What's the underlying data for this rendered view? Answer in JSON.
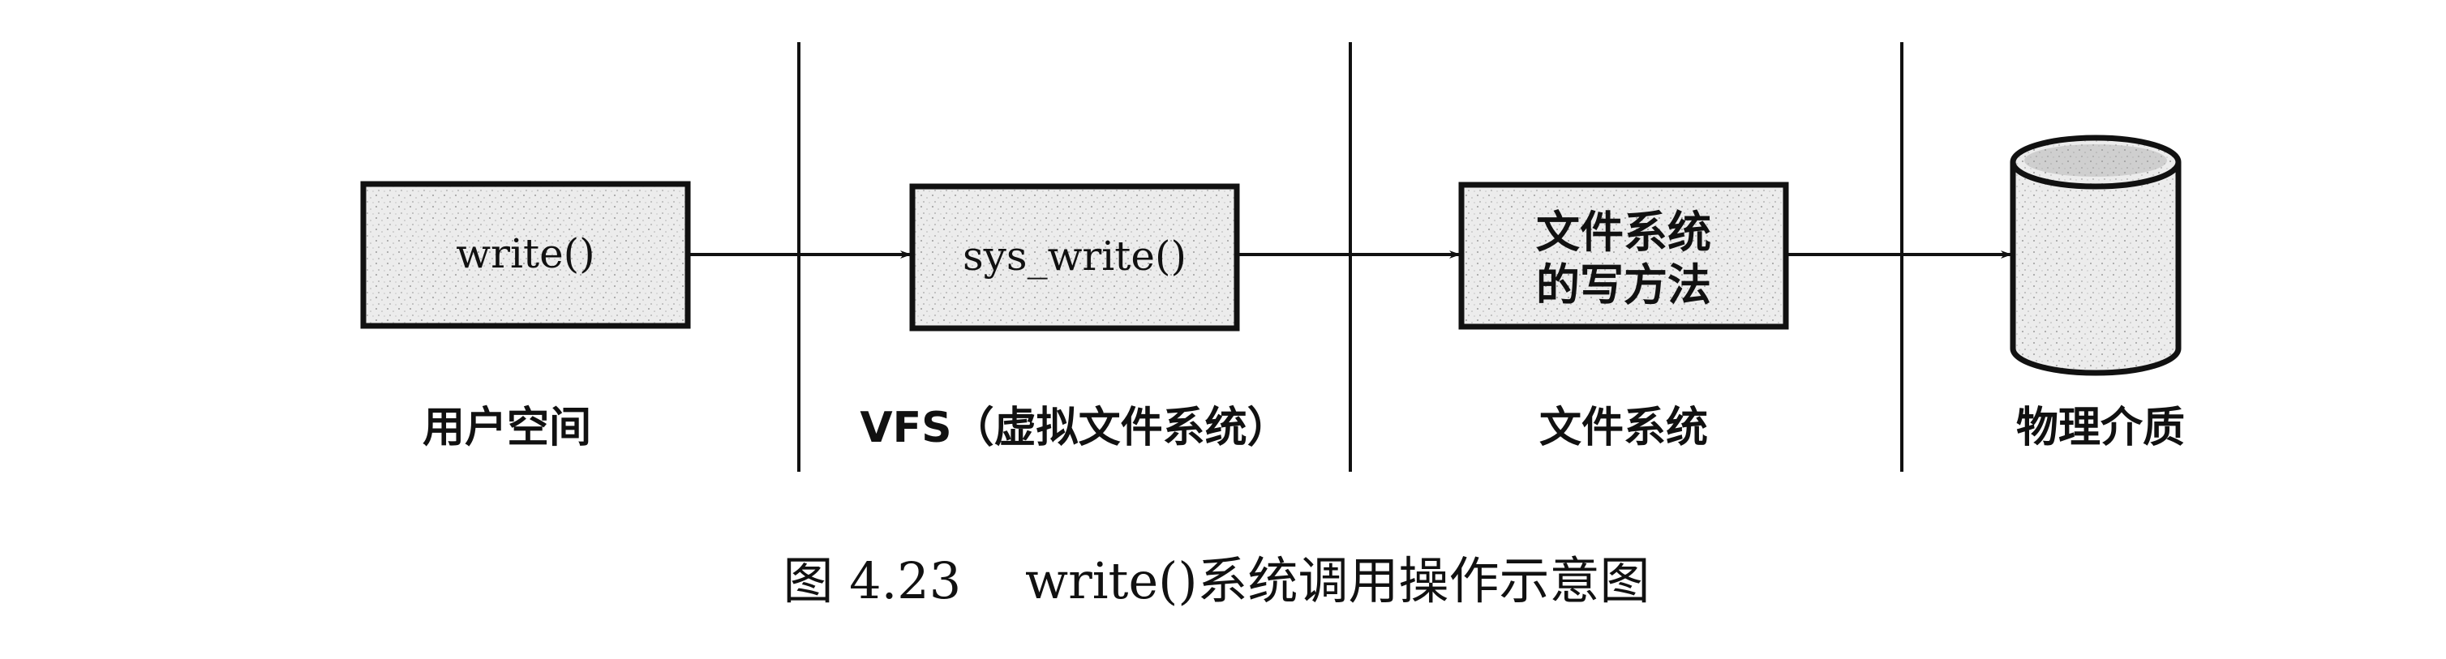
{
  "diagram": {
    "dividers": 3,
    "nodes": {
      "write": {
        "label": "write()"
      },
      "sys_write": {
        "label": "sys_write()"
      },
      "fs_write_line1": "文件系统",
      "fs_write_line2": "的写方法"
    },
    "regions": {
      "user_space": "用户空间",
      "vfs": "VFS（虚拟文件系统）",
      "filesystem": "文件系统",
      "physical_media": "物理介质"
    },
    "caption": "图 4.23    write()系统调用操作示意图",
    "colors": {
      "box_fill": "#e9e9e9",
      "stroke": "#111111"
    }
  }
}
